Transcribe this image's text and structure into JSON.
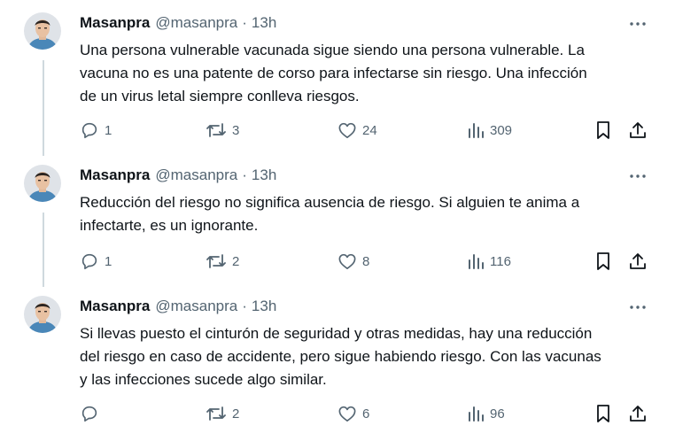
{
  "tweets": [
    {
      "name": "Masanpra",
      "handle": "@masanpra",
      "dot": "·",
      "time": "13h",
      "text": "Una persona vulnerable vacunada sigue siendo una persona vulnerable. La\nvacuna no es una patente de corso para infectarse sin riesgo. Una infección\nde un virus letal siempre conlleva riesgos.",
      "replies": "1",
      "retweets": "3",
      "likes": "24",
      "views": "309"
    },
    {
      "name": "Masanpra",
      "handle": "@masanpra",
      "dot": "·",
      "time": "13h",
      "text": "Reducción del riesgo no significa ausencia de riesgo. Si alguien te anima a\ninfectarte, es un ignorante.",
      "replies": "1",
      "retweets": "2",
      "likes": "8",
      "views": "116"
    },
    {
      "name": "Masanpra",
      "handle": "@masanpra",
      "dot": "·",
      "time": "13h",
      "text": "Si llevas puesto el cinturón de seguridad y otras medidas, hay una reducción\ndel riesgo en caso de accidente, pero sigue habiendo riesgo. Con las vacunas\ny las infecciones sucede algo similar.",
      "replies": "",
      "retweets": "2",
      "likes": "6",
      "views": "96"
    }
  ],
  "colors": {
    "text": "#0f1419",
    "secondary": "#536471",
    "thread_line": "#cfd9de"
  },
  "icons": [
    "reply-icon",
    "retweet-icon",
    "like-icon",
    "views-icon",
    "bookmark-icon",
    "share-icon",
    "more-icon"
  ]
}
